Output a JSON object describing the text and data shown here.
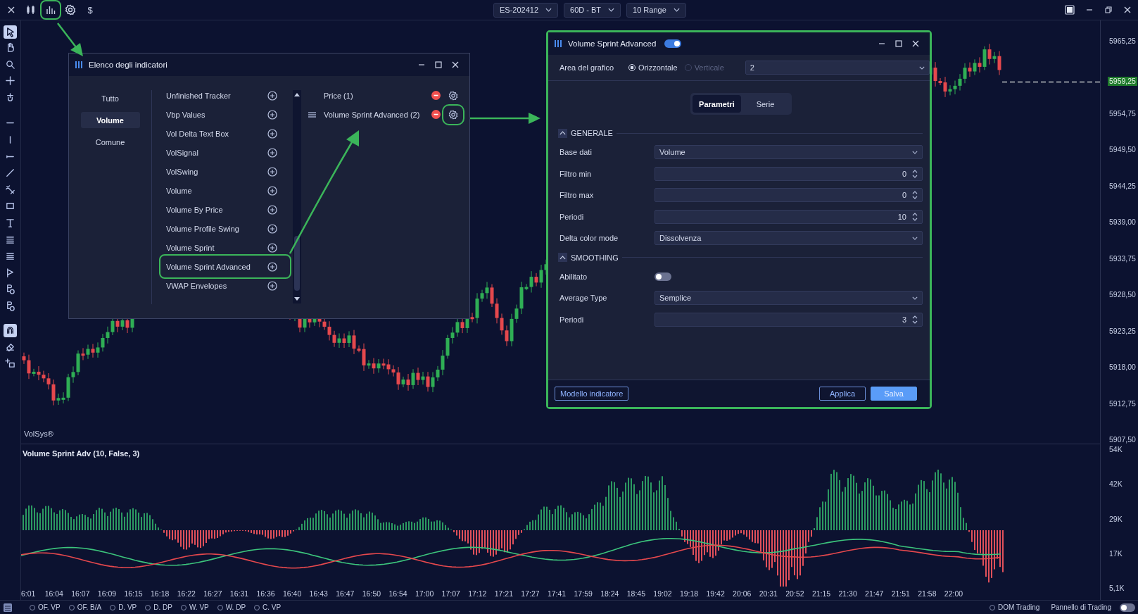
{
  "top_bar": {
    "tools": [
      {
        "kind": "close",
        "annotated": false
      },
      {
        "kind": "candles",
        "annotated": false
      },
      {
        "kind": "indicators",
        "annotated": true
      },
      {
        "kind": "settings",
        "annotated": false
      },
      {
        "kind": "currency",
        "label": "$",
        "annotated": false
      }
    ],
    "dropdowns": [
      "ES-202412",
      "60D - BT",
      "10 Range"
    ]
  },
  "left_toolbar": [
    {
      "kind": "pointer",
      "selected": true
    },
    {
      "kind": "hand",
      "selected": false
    },
    {
      "kind": "zoom",
      "selected": false
    },
    {
      "kind": "crosshair",
      "selected": false
    },
    {
      "kind": "snap",
      "selected": false
    },
    {
      "kind": "hline",
      "selected": false
    },
    {
      "kind": "vline",
      "selected": false
    },
    {
      "kind": "ray",
      "selected": false
    },
    {
      "kind": "line",
      "selected": false
    },
    {
      "kind": "channel",
      "selected": false
    },
    {
      "kind": "rectangle",
      "selected": false
    },
    {
      "kind": "text",
      "selected": false
    },
    {
      "kind": "fib",
      "selected": false
    },
    {
      "kind": "fib",
      "selected": false
    },
    {
      "kind": "flag",
      "selected": false
    },
    {
      "kind": "note",
      "selected": false
    },
    {
      "kind": "note",
      "selected": false
    },
    {
      "kind": "magnet",
      "selected": true
    },
    {
      "kind": "eraser",
      "selected": false
    },
    {
      "kind": "layers",
      "selected": false
    }
  ],
  "price_chart": {
    "watermark": "VolSys®",
    "last_price": "5959,25",
    "price_ticks": [
      "5965,25",
      "5954,75",
      "5949,50",
      "5944,25",
      "5939,00",
      "5933,75",
      "5928,50",
      "5923,25",
      "5918,00",
      "5912,75",
      "5907,50"
    ]
  },
  "indicator_panel": {
    "title": "Volume Sprint Adv (10, False, 3)",
    "ticks": [
      "54K",
      "42K",
      "29K",
      "17K",
      "5,1K"
    ]
  },
  "time_axis": [
    "6:01",
    "16:04",
    "16:07",
    "16:09",
    "16:15",
    "16:18",
    "16:22",
    "16:27",
    "16:31",
    "16:36",
    "16:40",
    "16:43",
    "16:47",
    "16:50",
    "16:54",
    "17:00",
    "17:07",
    "17:12",
    "17:21",
    "17:27",
    "17:41",
    "17:59",
    "18:24",
    "18:45",
    "19:02",
    "19:18",
    "19:42",
    "20:06",
    "20:31",
    "20:52",
    "21:15",
    "21:30",
    "21:47",
    "21:51",
    "21:58",
    "22:00"
  ],
  "status_bar": {
    "layouts": [
      {
        "label": "OF. VP",
        "selected": false
      },
      {
        "label": "OF. B/A",
        "selected": false
      },
      {
        "label": "D. VP",
        "selected": false
      },
      {
        "label": "D. DP",
        "selected": false
      },
      {
        "label": "W. VP",
        "selected": false
      },
      {
        "label": "W. DP",
        "selected": false
      },
      {
        "label": "C. VP",
        "selected": false
      }
    ],
    "dom_trading": {
      "label": "DOM Trading",
      "selected": false
    },
    "trading_panel": {
      "label": "Pannello di Trading",
      "on": false
    }
  },
  "indicator_list_dialog": {
    "title": "Elenco degli indicatori",
    "categories": [
      {
        "label": "Tutto",
        "selected": false
      },
      {
        "label": "Volume",
        "selected": true
      },
      {
        "label": "Comune",
        "selected": false
      }
    ],
    "available": [
      {
        "label": "Unfinished Tracker",
        "annotated": false
      },
      {
        "label": "Vbp Values",
        "annotated": false
      },
      {
        "label": "Vol Delta Text Box",
        "annotated": false
      },
      {
        "label": "VolSignal",
        "annotated": false
      },
      {
        "label": "VolSwing",
        "annotated": false
      },
      {
        "label": "Volume",
        "annotated": false
      },
      {
        "label": "Volume By Price",
        "annotated": false
      },
      {
        "label": "Volume Profile Swing",
        "annotated": false
      },
      {
        "label": "Volume Sprint",
        "annotated": false
      },
      {
        "label": "Volume Sprint Advanced",
        "annotated": true
      },
      {
        "label": "VWAP Envelopes",
        "annotated": false
      }
    ],
    "applied": [
      {
        "label": "Price (1)",
        "draggable": false,
        "annotated": false
      },
      {
        "label": "Volume Sprint Advanced (2)",
        "draggable": true,
        "annotated": true
      }
    ]
  },
  "settings_dialog": {
    "title": "Volume Sprint Advanced",
    "enabled": true,
    "annotated": true,
    "chart_area": {
      "label": "Area del grafico",
      "options": [
        {
          "label": "Orizzontale",
          "selected": true,
          "disabled": false
        },
        {
          "label": "Verticale",
          "selected": false,
          "disabled": true
        }
      ],
      "value": "2"
    },
    "tabs": [
      {
        "label": "Parametri",
        "selected": true
      },
      {
        "label": "Serie",
        "selected": false
      }
    ],
    "sections": [
      {
        "title": "GENERALE",
        "expanded": true,
        "fields": [
          {
            "label": "Base dati",
            "kind": "select",
            "value": "Volume"
          },
          {
            "label": "Filtro min",
            "kind": "number",
            "value": "0"
          },
          {
            "label": "Filtro max",
            "kind": "number",
            "value": "0"
          },
          {
            "label": "Periodi",
            "kind": "number",
            "value": "10"
          },
          {
            "label": "Delta color mode",
            "kind": "select",
            "value": "Dissolvenza"
          }
        ]
      },
      {
        "title": "SMOOTHING",
        "expanded": true,
        "fields": [
          {
            "label": "Abilitato",
            "kind": "toggle",
            "on": false
          },
          {
            "label": "Average Type",
            "kind": "select",
            "value": "Semplice"
          },
          {
            "label": "Periodi",
            "kind": "number",
            "value": "3"
          }
        ]
      }
    ],
    "buttons": [
      {
        "label": "Modello indicatore",
        "kind": "outline"
      },
      {
        "label": "Applica",
        "kind": "outline"
      },
      {
        "label": "Salva",
        "kind": "primary"
      }
    ]
  }
}
